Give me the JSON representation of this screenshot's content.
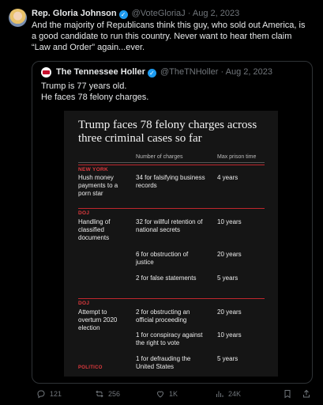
{
  "tweet": {
    "author_name": "Rep. Gloria Johnson",
    "handle": "@VoteGloriaJ",
    "separator": "·",
    "date": "Aug 2, 2023",
    "verified_glyph": "✓",
    "text": "And the majority of Republicans think this guy, who sold out America, is a good candidate to run this country. Never want to hear them claim “Law and Order” again...ever."
  },
  "quote": {
    "author_name": "The Tennessee Holler",
    "handle": "@TheTNHoller",
    "separator": "·",
    "date": "Aug 2, 2023",
    "verified_glyph": "✓",
    "line1": "Trump is 77 years old.",
    "line2": "He faces 78 felony charges."
  },
  "graphic": {
    "title": "Trump faces 78 felony charges across three criminal cases so far",
    "col_charges": "Number of charges",
    "col_prison": "Max prison time",
    "sections": [
      {
        "label": "NEW YORK",
        "case": "Hush money payments to a porn star",
        "rows": [
          {
            "charge": "34 for falsifying business records",
            "years": "4 years"
          }
        ]
      },
      {
        "label": "DOJ",
        "case": "Handling of classified documents",
        "rows": [
          {
            "charge": "32 for willful retention of national secrets",
            "years": "10 years"
          },
          {
            "charge": "6 for obstruction of justice",
            "years": "20 years"
          },
          {
            "charge": "2 for false statements",
            "years": "5 years"
          }
        ]
      },
      {
        "label": "DOJ",
        "case": "Attempt to overturn 2020 election",
        "rows": [
          {
            "charge": "2 for obstructing an official proceeding",
            "years": "20 years"
          },
          {
            "charge": "1 for conspiracy against the right to vote",
            "years": "10 years"
          },
          {
            "charge": "1 for defrauding the United States",
            "years": "5 years"
          }
        ]
      }
    ],
    "source": "POLITICO"
  },
  "actions": {
    "replies": "121",
    "reposts": "256",
    "likes": "1K",
    "views": "24K"
  },
  "colors": {
    "background": "#000000",
    "accent_red": "#c0272d",
    "verified_blue": "#1d9bf0",
    "muted_text": "#71767b"
  },
  "icons": [
    "reply-icon",
    "repost-icon",
    "like-icon",
    "views-icon",
    "bookmark-icon",
    "share-icon",
    "verified-badge-icon"
  ]
}
